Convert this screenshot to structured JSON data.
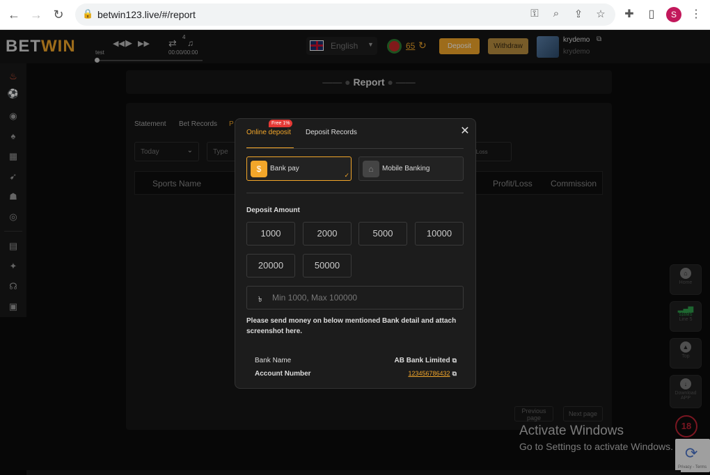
{
  "browser": {
    "url": "betwin123.live/#/report",
    "profile_initial": "S"
  },
  "header": {
    "logo_prefix": "BET",
    "logo_suffix": "WIN",
    "player": {
      "name": "test",
      "queue_count": "4",
      "time": "00:00/00:00",
      "progress": 0
    },
    "language": "English",
    "balance": "65",
    "deposit_label": "Deposit",
    "withdraw_label": "Withdraw",
    "username": "krydemo",
    "username_secondary": "krydemo"
  },
  "report": {
    "title": "Report",
    "tabs": [
      "Statement",
      "Bet Records",
      "P"
    ],
    "filters": {
      "period": "Today",
      "type": "Type",
      "profit_loss_sel": "it & Loss"
    },
    "columns": [
      "Sports Name",
      "Profit/Loss",
      "Commission"
    ],
    "prev_page": "Previous page",
    "next_page": "Next page"
  },
  "floating": {
    "home": "Home",
    "signal": "516MS",
    "line": "Line 5",
    "top": "Top",
    "download": "Download APP",
    "age": "18"
  },
  "windows_notice": {
    "title": "Activate Windows",
    "subtitle": "Go to Settings to activate Windows.",
    "recaptcha": "Privacy - Terms"
  },
  "modal": {
    "tabs": {
      "online": "Online deposit",
      "records": "Deposit Records",
      "badge": "Free 1%"
    },
    "pay_options": {
      "bank": "Bank pay",
      "mobile": "Mobile Banking"
    },
    "amount_label": "Deposit Amount",
    "amounts": [
      "1000",
      "2000",
      "5000",
      "10000",
      "20000",
      "50000"
    ],
    "currency_symbol": "৳",
    "amount_placeholder": "Min 1000, Max 100000",
    "note": "Please send money on below mentioned Bank detail and attach screenshot here.",
    "bank_name_label": "Bank Name",
    "bank_name_value": "AB Bank Limited",
    "account_label": "Account Number",
    "account_value": "123456786432"
  },
  "colors": {
    "accent": "#f2a62a",
    "badge": "#e53935"
  }
}
